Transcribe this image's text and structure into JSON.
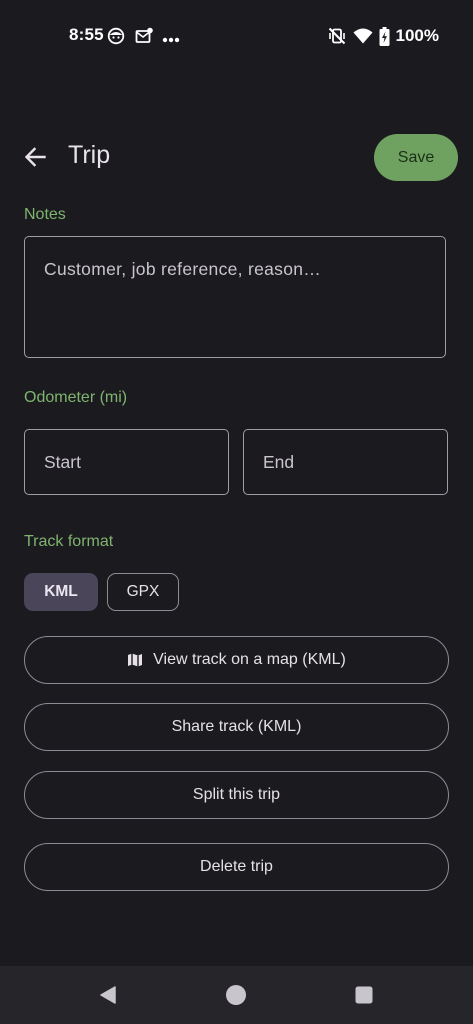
{
  "status_bar": {
    "time": "8:55",
    "battery": "100%",
    "icons": [
      "face-icon",
      "mail-notification-icon",
      "more-dots-icon",
      "vibrate-off-icon",
      "wifi-icon",
      "battery-charging-icon"
    ]
  },
  "app_bar": {
    "title": "Trip",
    "back_icon": "arrow-back-icon",
    "save_label": "Save"
  },
  "notes": {
    "label": "Notes",
    "placeholder": "Customer, job reference, reason…"
  },
  "odometer": {
    "label": "Odometer (mi)",
    "start_placeholder": "Start",
    "end_placeholder": "End"
  },
  "track_format": {
    "label": "Track format",
    "options": [
      "KML",
      "GPX"
    ],
    "selected": "KML"
  },
  "actions": {
    "view_map": "View track on a map (KML)",
    "view_map_icon": "map-icon",
    "share": "Share track (KML)",
    "split": "Split this trip",
    "delete": "Delete trip"
  },
  "nav_bar": {
    "icons": [
      "back-triangle-icon",
      "home-circle-icon",
      "recents-square-icon"
    ]
  },
  "colors": {
    "background": "#1b1a1f",
    "accent_green": "#7fb46f",
    "save_button": "#6fa260",
    "selected_chip": "#4a4558",
    "outline": "#8f8a93"
  }
}
